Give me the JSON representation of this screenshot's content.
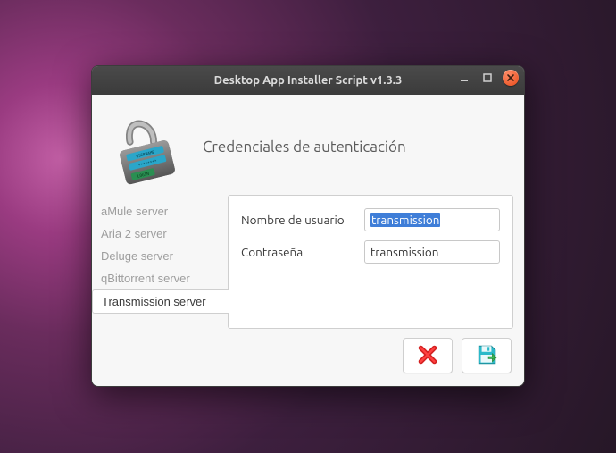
{
  "window": {
    "title": "Desktop App Installer Script v1.3.3"
  },
  "header": {
    "heading": "Credenciales de autenticación"
  },
  "tabs": [
    {
      "label": "aMule server",
      "active": false
    },
    {
      "label": "Aria 2 server",
      "active": false
    },
    {
      "label": "Deluge server",
      "active": false
    },
    {
      "label": "qBittorrent server",
      "active": false
    },
    {
      "label": "Transmission server",
      "active": true
    }
  ],
  "form": {
    "username_label": "Nombre de usuario",
    "username_value": "transmission",
    "password_label": "Contraseña",
    "password_value": "transmission"
  },
  "buttons": {
    "cancel_name": "cancel",
    "save_name": "save"
  }
}
